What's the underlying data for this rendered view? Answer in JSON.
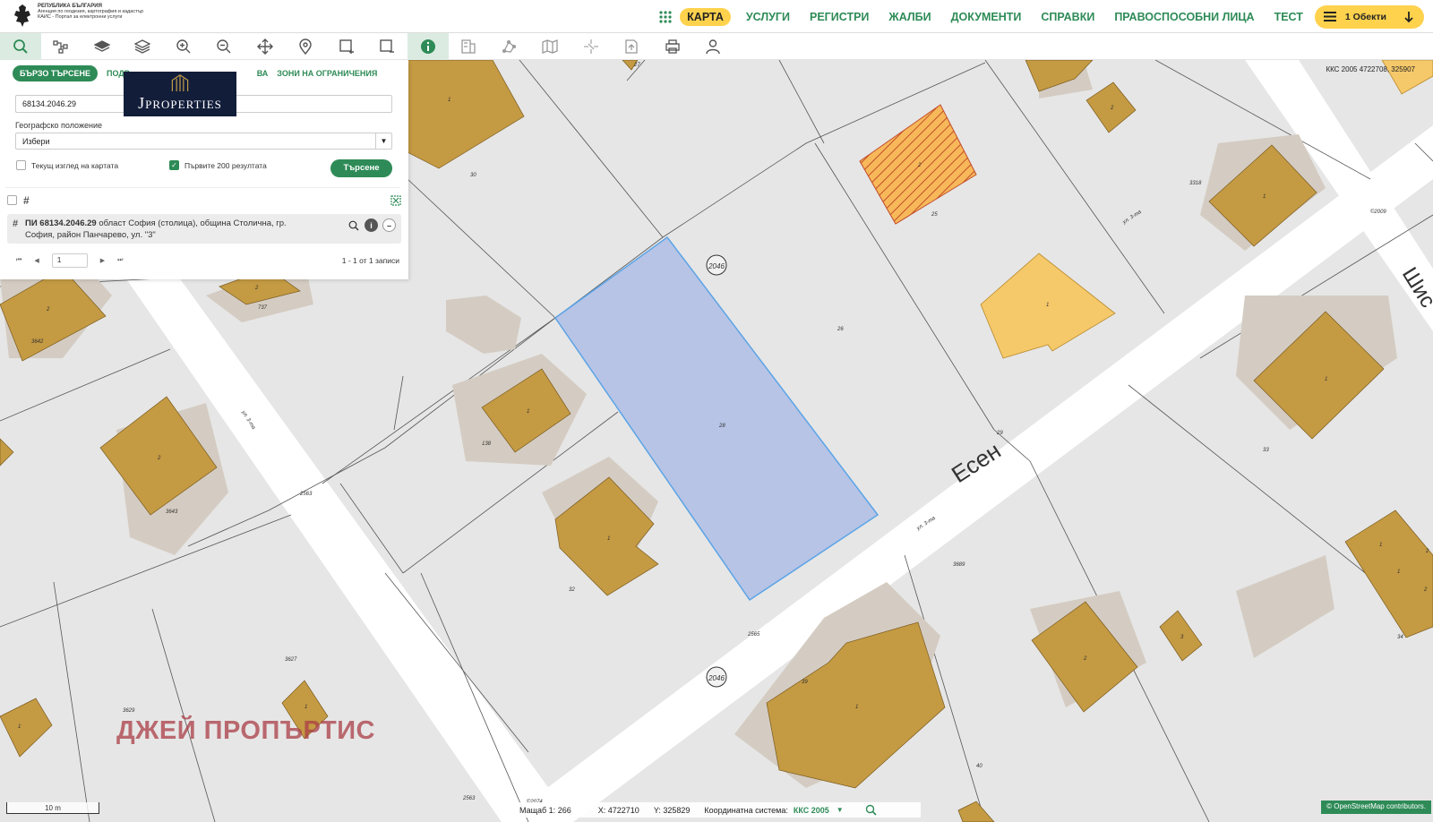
{
  "header": {
    "logo_lines": [
      "РЕПУБЛИКА БЪЛГАРИЯ",
      "Агенция по геодезия, картография и кадастър",
      "КАИС - Портал за електронни услуги"
    ],
    "nav": [
      "КАРТА",
      "УСЛУГИ",
      "РЕГИСТРИ",
      "ЖАЛБИ",
      "ДОКУМЕНТИ",
      "СПРАВКИ",
      "ПРАВОСПОСОБНИ ЛИЦА",
      "ТЕСТ"
    ],
    "objects_label": "1 Обекти"
  },
  "toolbar": {
    "tools": [
      "search-icon",
      "route-icon",
      "layers-icon",
      "layers-stack-icon",
      "zoom-in-icon",
      "zoom-out-icon",
      "pan-icon",
      "marker-icon",
      "select-area-icon",
      "select-rect-icon",
      "info-icon",
      "measure-icon",
      "draw-icon",
      "map-icon",
      "split-icon",
      "export-icon",
      "print-icon",
      "user-icon"
    ],
    "active": "info-icon"
  },
  "panel": {
    "tabs": [
      "БЪРЗО ТЪРСЕНЕ",
      "ПОДР",
      "ВА",
      "ЗОНИ НА ОГРАНИЧЕНИЯ"
    ],
    "overlay_brand": "PROPERTIES",
    "search_value": "68134.2046.29",
    "geo_label": "Географско положение",
    "geo_value": "Избери",
    "current_view_label": "Текущ изглед на картата",
    "first200_label": "Първите 200 резултата",
    "search_button": "Търсене",
    "result_bold": "ПИ 68134.2046.29",
    "result_rest": " област София (столица), община Столична, гр. София, район Панчарево, ул. \"3\"",
    "page": "1",
    "records": "1 - 1 от 1 записи"
  },
  "map": {
    "kks_top": "ККС 2005 4722708, 325907",
    "street_name": "Есен",
    "street_name_right": "Шис",
    "watermark": "ДЖЕЙ ПРОПЪРТИС",
    "block_labels": [
      "2046",
      "2046"
    ],
    "lot_numbers": [
      "30",
      "27",
      "26",
      "25",
      "3318",
      "29",
      "28",
      "138",
      "737",
      "3642",
      "3643",
      "2563",
      "2565",
      "32",
      "33",
      "39",
      "34",
      "3689",
      "3627",
      "3629",
      "40",
      "2563"
    ],
    "building_numbers": [
      "1",
      "2",
      "1",
      "2",
      "1",
      "1",
      "1",
      "2",
      "1",
      "1",
      "1",
      "2",
      "1",
      "2",
      "2",
      "1",
      "1",
      "3",
      "2",
      "2"
    ],
    "street_labels": [
      "ул. 3-та",
      "ул. 3-та",
      "ул. 3-та"
    ],
    "copyright_labels": [
      "©2009",
      "©2074"
    ]
  },
  "status": {
    "scale_label": "Мащаб 1:",
    "scale_value": "266",
    "x_label": "X:",
    "x_value": "4722710",
    "y_label": "Y:",
    "y_value": "325829",
    "coord_label": "Координатна система:",
    "coord_value": "ККС 2005",
    "scalebar": "10 m",
    "attribution": "© OpenStreetMap contributors."
  },
  "colors": {
    "accent": "#2e8b57",
    "highlight": "#ffd24d",
    "parcel_selected": "#b7c4e6",
    "building": "#c49a43",
    "building_light": "#f5c86a",
    "road": "#ffffff",
    "land": "#e6e6e6"
  }
}
